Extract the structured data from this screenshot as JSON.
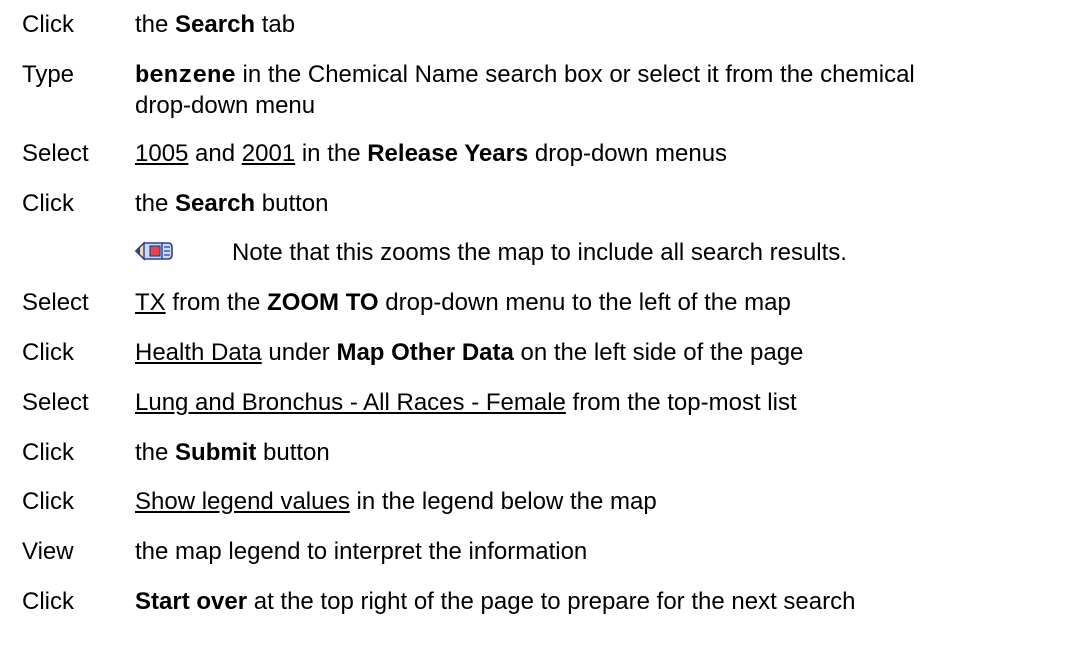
{
  "steps": [
    {
      "verb": "Click",
      "parts": [
        "the ",
        "Search",
        " tab"
      ]
    },
    {
      "verb": "Type",
      "parts": [
        "benzene",
        " in the Chemical Name search box or select it from the chemical",
        "drop-down menu"
      ]
    },
    {
      "verb": "Select",
      "parts": [
        "1005",
        " and ",
        "2001",
        " in the ",
        "Release Years",
        " drop-down menus"
      ]
    },
    {
      "verb": "Click",
      "parts": [
        "the ",
        "Search",
        " button"
      ]
    },
    {
      "verb": "Select",
      "parts": [
        "TX",
        " from the ",
        "ZOOM TO",
        " drop-down menu to the left of the map"
      ]
    },
    {
      "verb": "Click",
      "parts": [
        "Health Data",
        " under ",
        "Map Other Data",
        " on the left side of the page"
      ]
    },
    {
      "verb": "Select",
      "parts": [
        "Lung and Bronchus - All Races - Female",
        " from the top-most list"
      ]
    },
    {
      "verb": "Click",
      "parts": [
        "the ",
        "Submit",
        " button"
      ]
    },
    {
      "verb": "Click",
      "parts": [
        "Show legend values",
        " in the legend below the map"
      ]
    },
    {
      "verb": "View",
      "parts": [
        "the map legend to interpret the information"
      ]
    },
    {
      "verb": "Click",
      "parts": [
        "Start over",
        " at the top right of the page to prepare for the next search"
      ]
    }
  ],
  "note": {
    "icon": "pencil-note-icon",
    "text": "Note that this zooms the map to include all search results."
  }
}
